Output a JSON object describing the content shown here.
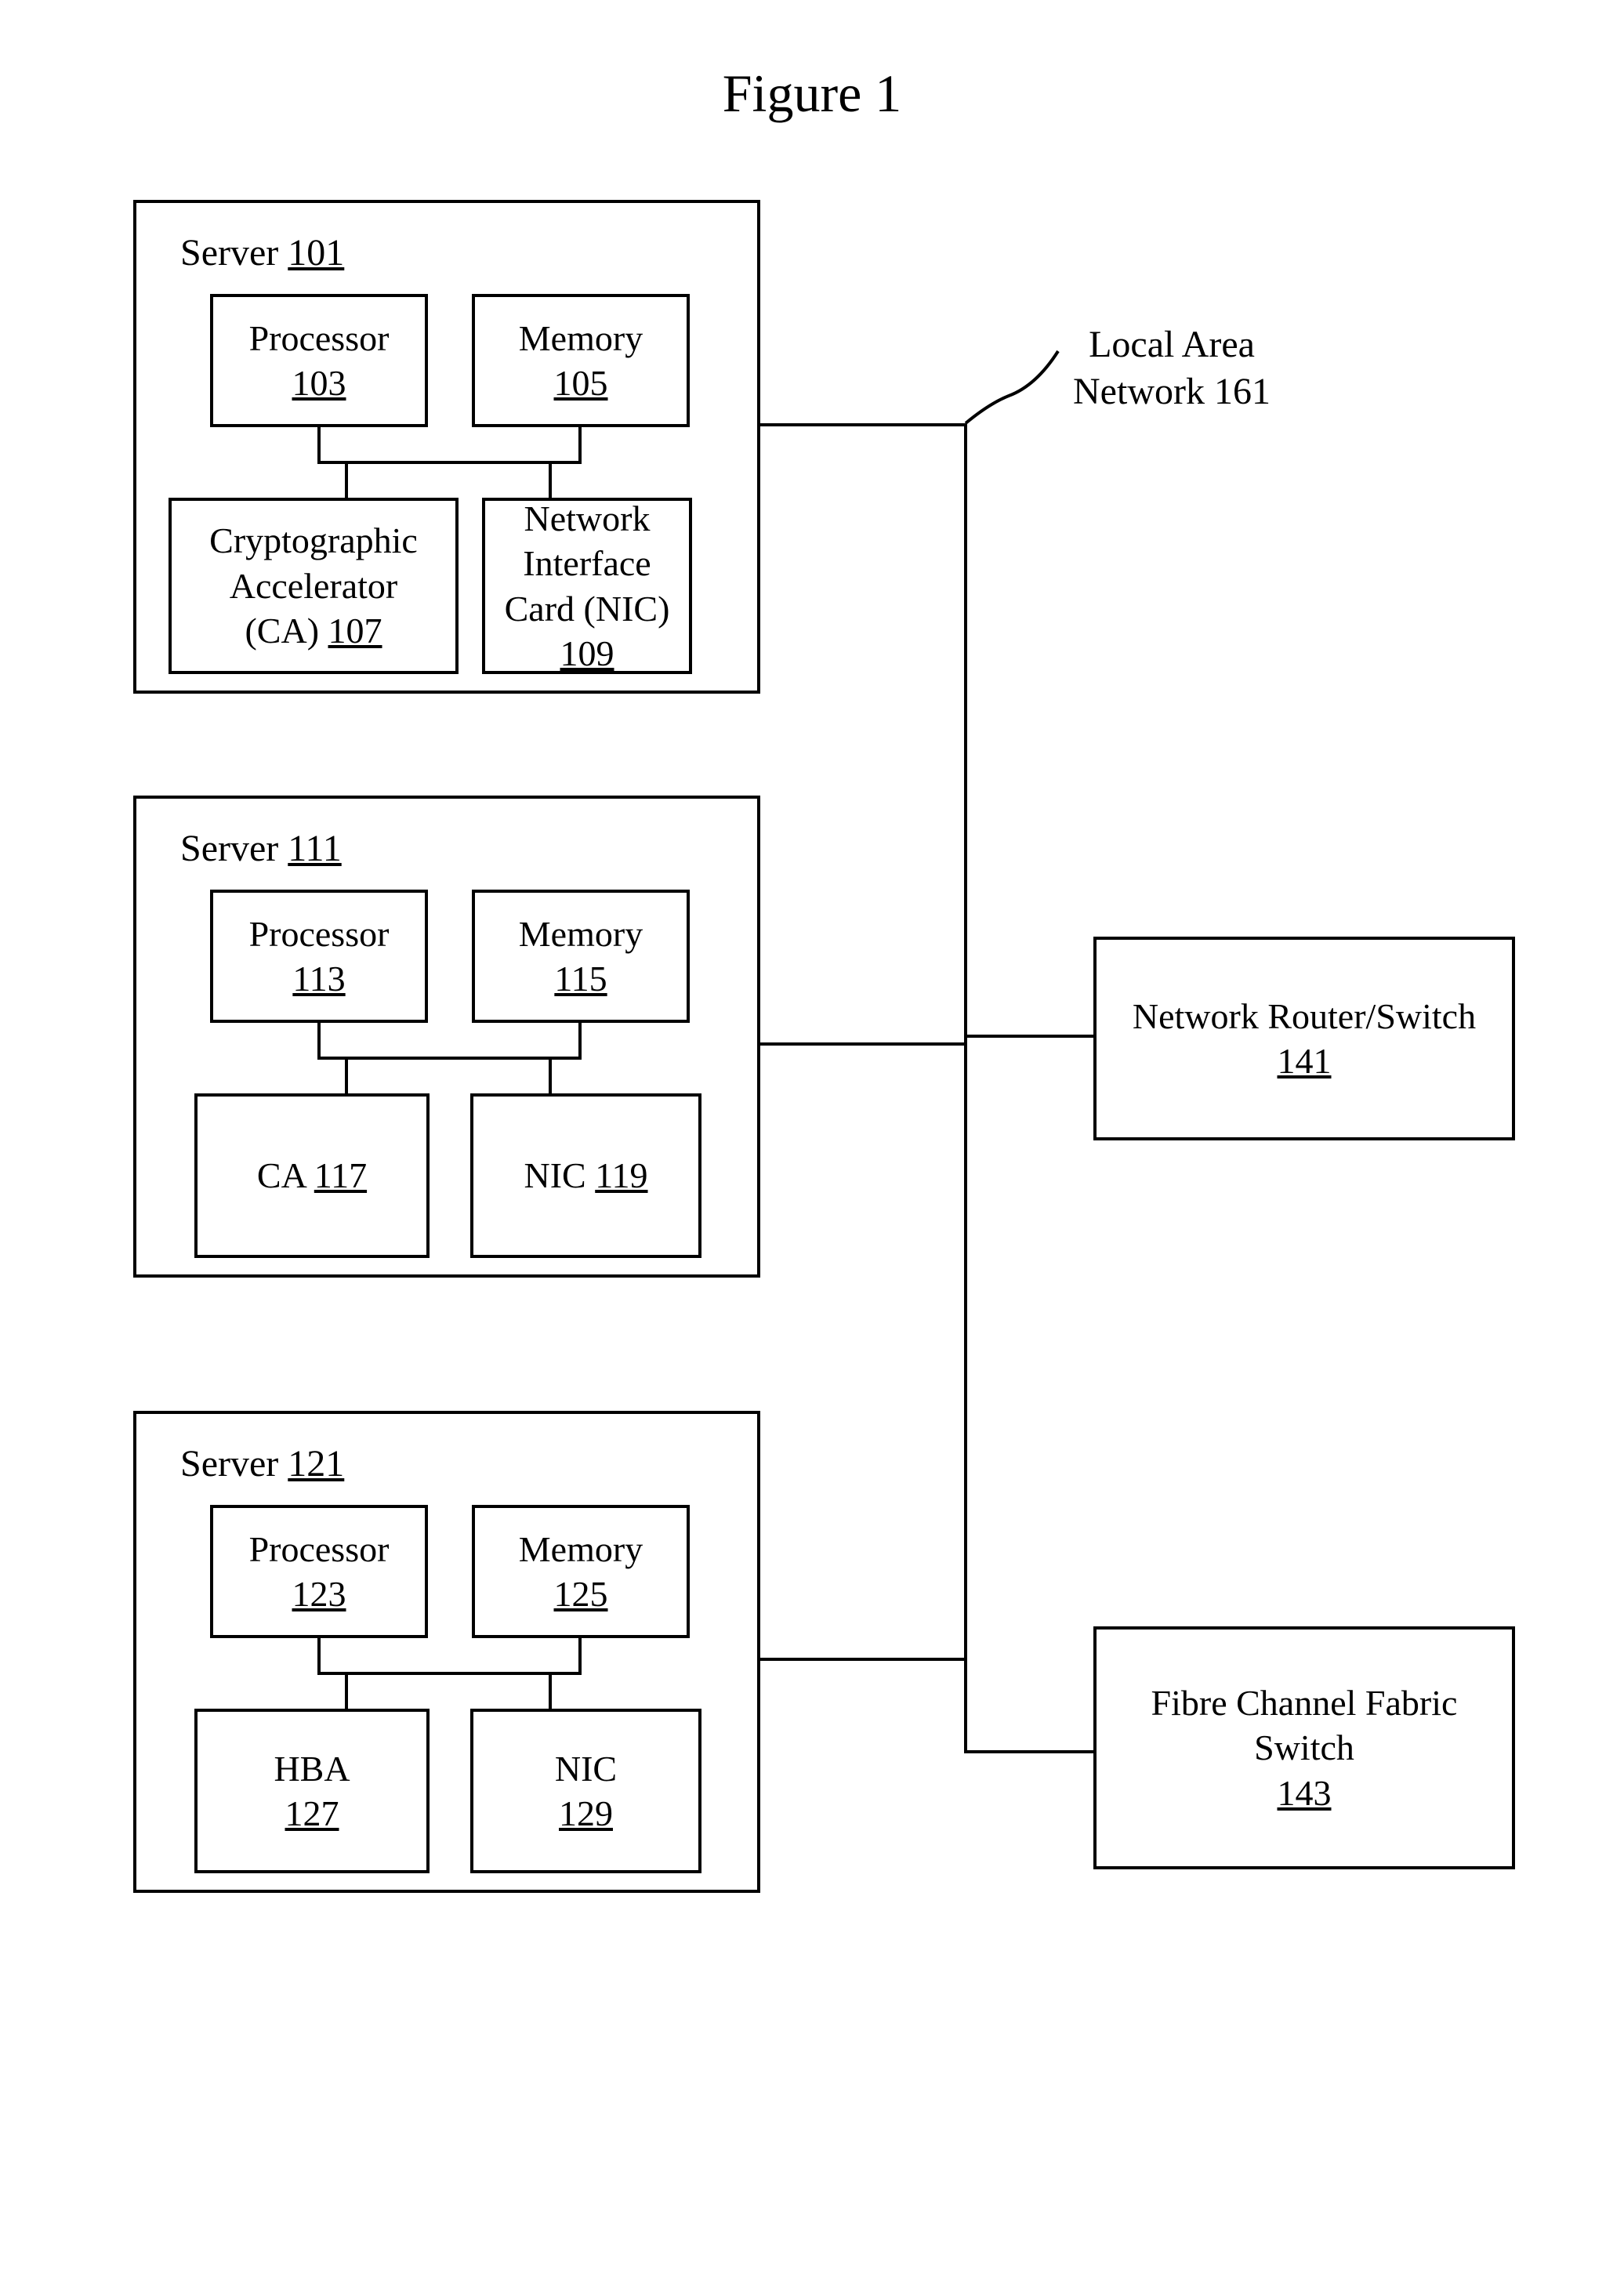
{
  "title": "Figure 1",
  "lan": {
    "l1": "Local Area",
    "l2": "Network 161"
  },
  "servers": [
    {
      "label_prefix": "Server ",
      "ref": "101",
      "proc": {
        "name": "Processor",
        "ref": "103"
      },
      "mem": {
        "name": "Memory",
        "ref": "105"
      },
      "left": {
        "l1": "Cryptographic",
        "l2": "Accelerator",
        "l3": "(CA) ",
        "ref": "107"
      },
      "right": {
        "l1": "Network",
        "l2": "Interface",
        "l3": "Card (NIC)",
        "ref": "109"
      }
    },
    {
      "label_prefix": "Server ",
      "ref": "111",
      "proc": {
        "name": "Processor",
        "ref": "113"
      },
      "mem": {
        "name": "Memory",
        "ref": "115"
      },
      "left": {
        "l1": "CA ",
        "ref": "117"
      },
      "right": {
        "l1": "NIC ",
        "ref": "119"
      }
    },
    {
      "label_prefix": "Server ",
      "ref": "121",
      "proc": {
        "name": "Processor",
        "ref": "123"
      },
      "mem": {
        "name": "Memory",
        "ref": "125"
      },
      "left": {
        "l1": "HBA",
        "ref": "127"
      },
      "right": {
        "l1": "NIC",
        "ref": "129"
      }
    }
  ],
  "router": {
    "l1": "Network Router/Switch",
    "ref": "141"
  },
  "fcswitch": {
    "l1": "Fibre Channel Fabric",
    "l2": "Switch",
    "ref": "143"
  }
}
